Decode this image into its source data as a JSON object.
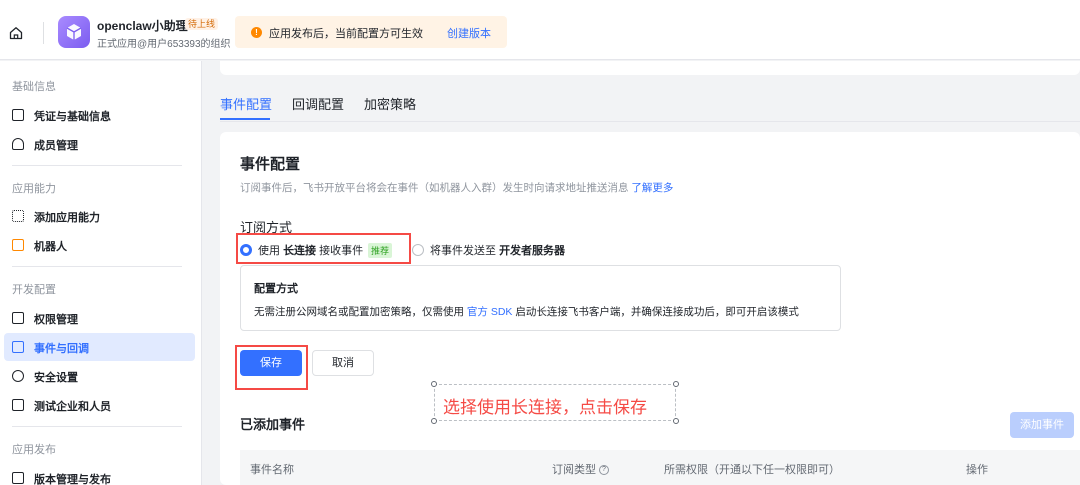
{
  "header": {
    "app_name": "openclaw小助理",
    "app_badge": "待上线",
    "app_sub": "正式应用@用户653393的组织",
    "notice_text": "应用发布后，当前配置方可生效",
    "notice_link": "创建版本"
  },
  "sidebar": {
    "groups": [
      {
        "label": "基础信息",
        "items": [
          {
            "label": "凭证与基础信息",
            "icon": "id-card-icon"
          },
          {
            "label": "成员管理",
            "icon": "member-icon"
          }
        ]
      },
      {
        "label": "应用能力",
        "items": [
          {
            "label": "添加应用能力",
            "icon": "grid-icon"
          },
          {
            "label": "机器人",
            "icon": "robot-icon"
          }
        ]
      },
      {
        "label": "开发配置",
        "items": [
          {
            "label": "权限管理",
            "icon": "lock-icon"
          },
          {
            "label": "事件与回调",
            "icon": "event-icon",
            "active": true
          },
          {
            "label": "安全设置",
            "icon": "shield-icon"
          },
          {
            "label": "测试企业和人员",
            "icon": "test-icon"
          }
        ]
      },
      {
        "label": "应用发布",
        "items": [
          {
            "label": "版本管理与发布",
            "icon": "upload-icon"
          }
        ]
      }
    ]
  },
  "tabs": [
    "事件配置",
    "回调配置",
    "加密策略"
  ],
  "event_config": {
    "title": "事件配置",
    "desc": "订阅事件后，飞书开放平台将会在事件（如机器人入群）发生时向请求地址推送消息",
    "desc_link": "了解更多",
    "sub_title": "订阅方式",
    "option1_prefix": "使用",
    "option1_bold": "长连接",
    "option1_suffix": "接收事件",
    "option1_tag": "推荐",
    "option2_prefix": "将事件发送至",
    "option2_bold": "开发者服务器",
    "cfg_title": "配置方式",
    "cfg_text_a": "无需注册公网域名或配置加密策略，仅需使用",
    "cfg_text_link": "官方 SDK",
    "cfg_text_b": "启动长连接飞书客户端，并确保连接成功后，即可开启该模式",
    "save": "保存",
    "cancel": "取消",
    "annotation": "选择使用长连接，点击保存"
  },
  "added": {
    "title": "已添加事件",
    "add_button": "添加事件",
    "columns": [
      "事件名称",
      "订阅类型",
      "所需权限（开通以下任一权限即可）",
      "操作"
    ]
  },
  "colors": {
    "accent": "#3370ff",
    "highlight": "#f54a45"
  }
}
